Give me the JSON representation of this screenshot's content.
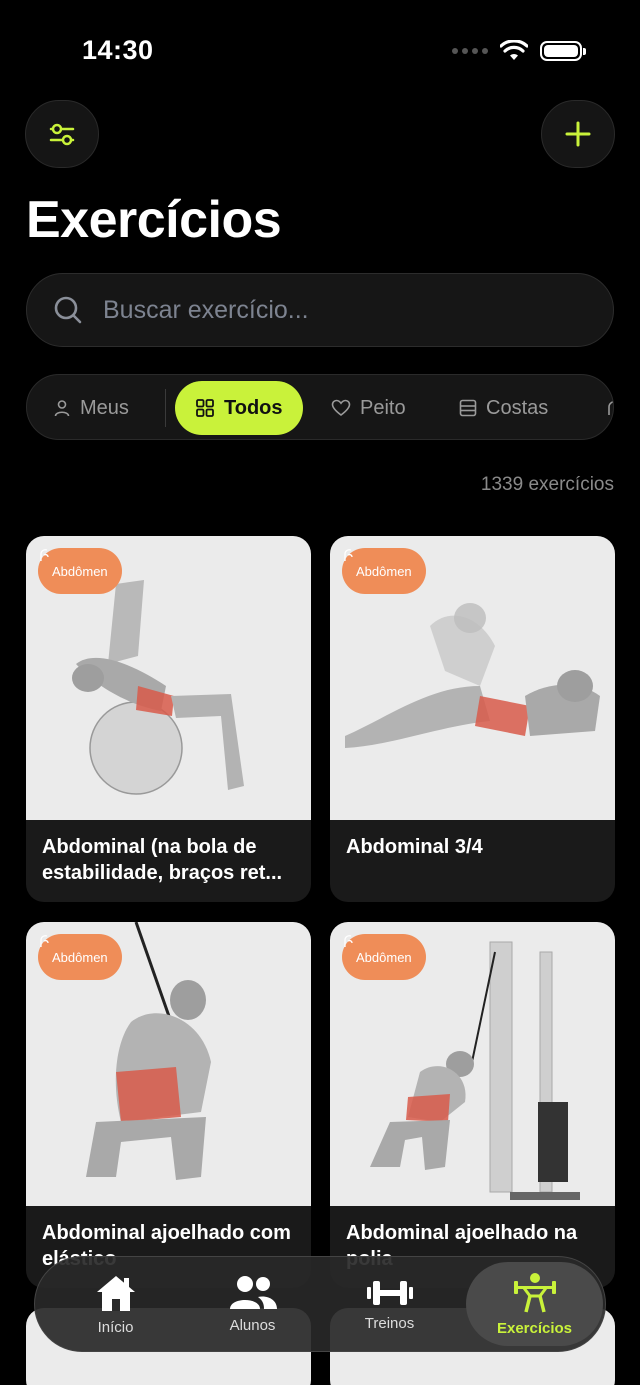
{
  "status": {
    "time": "14:30"
  },
  "header": {
    "title": "Exercícios"
  },
  "search": {
    "placeholder": "Buscar exercício..."
  },
  "filters": [
    {
      "label": "Meus",
      "icon": "person-icon"
    },
    {
      "label": "Todos",
      "icon": "grid-icon",
      "active": true
    },
    {
      "label": "Peito",
      "icon": "heart-icon"
    },
    {
      "label": "Costas",
      "icon": "back-icon"
    }
  ],
  "count": "1339 exercícios",
  "cards": [
    {
      "tag": "Abdômen",
      "title": "Abdominal (na bola de estabilidade, braços ret..."
    },
    {
      "tag": "Abdômen",
      "title": "Abdominal 3/4"
    },
    {
      "tag": "Abdômen",
      "title": "Abdominal ajoelhado com elástico"
    },
    {
      "tag": "Abdômen",
      "title": "Abdominal ajoelhado na polia"
    }
  ],
  "nav": [
    {
      "label": "Início",
      "icon": "home-icon"
    },
    {
      "label": "Alunos",
      "icon": "users-icon"
    },
    {
      "label": "Treinos",
      "icon": "dumbbell-icon"
    },
    {
      "label": "Exercícios",
      "icon": "weightlifter-icon",
      "active": true
    }
  ],
  "colors": {
    "accent": "#c9f23a",
    "tag": "#ef8d58",
    "background": "#000000"
  }
}
